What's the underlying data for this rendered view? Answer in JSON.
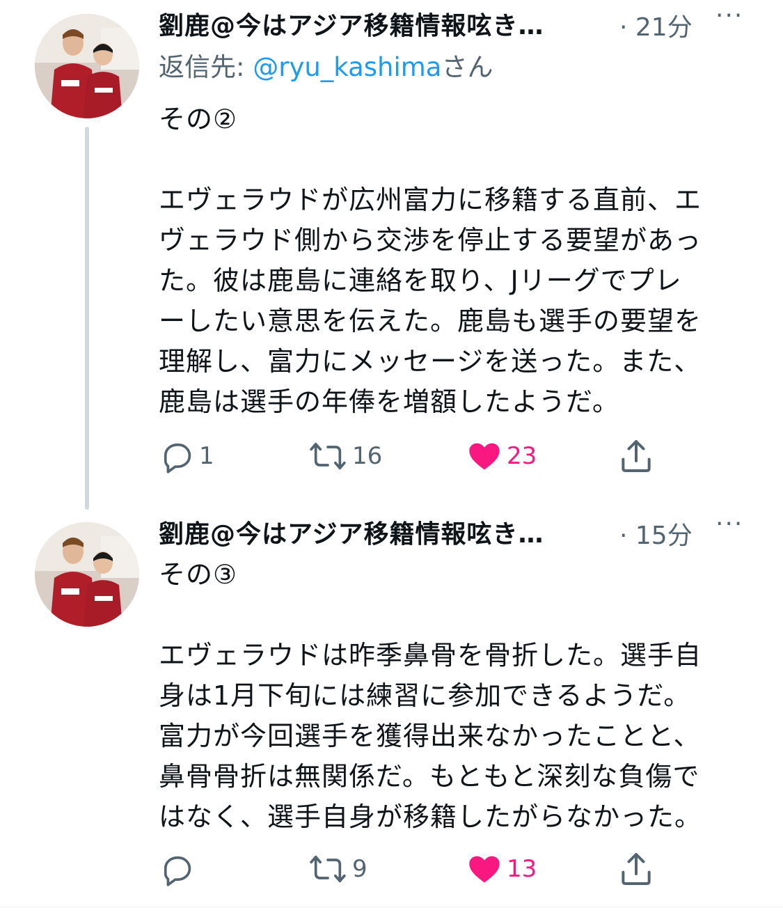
{
  "colors": {
    "text": "#0f1419",
    "secondary": "#536471",
    "link": "#1d9bf0",
    "like": "#f91880",
    "thread_line": "#cfd9de"
  },
  "tweets": [
    {
      "author": "劉鹿@今はアジア移籍情報呟き…",
      "time": "· 21分",
      "more": "···",
      "reply_prefix": "返信先: ",
      "reply_handle": "@ryu_kashima",
      "reply_suffix": "さん",
      "text": "その②\n\nエヴェラウドが広州富力に移籍する直前、エ\nヴェラウド側から交渉を停止する要望があっ\nた。彼は鹿島に連絡を取り、Jリーグでプレ\nーしたい意思を伝えた。鹿島も選手の要望を\n理解し、富力にメッセージを送った。また、\n鹿島は選手の年俸を増額したようだ。",
      "replies": "1",
      "retweets": "16",
      "likes": "23",
      "icons": [
        "reply-icon",
        "retweet-icon",
        "like-icon",
        "share-icon"
      ]
    },
    {
      "author": "劉鹿@今はアジア移籍情報呟き…",
      "time": "· 15分",
      "more": "···",
      "text": "その③\n\nエヴェラウドは昨季鼻骨を骨折した。選手自\n身は1月下旬には練習に参加できるようだ。\n富力が今回選手を獲得出来なかったことと、\n鼻骨骨折は無関係だ。もともと深刻な負傷で\nはなく、選手自身が移籍したがらなかった。",
      "replies": "",
      "retweets": "9",
      "likes": "13",
      "icons": [
        "reply-icon",
        "retweet-icon",
        "like-icon",
        "share-icon"
      ]
    }
  ]
}
